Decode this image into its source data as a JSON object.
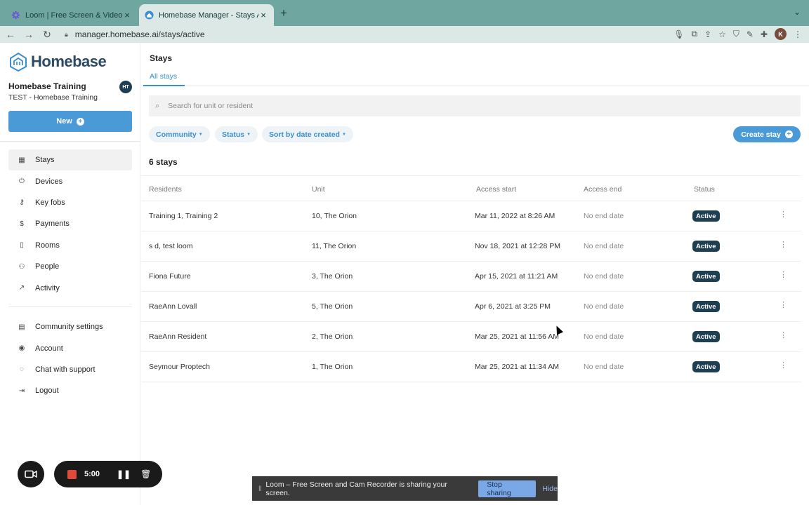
{
  "browser": {
    "tabs": [
      {
        "title": "Loom | Free Screen & Video Re"
      },
      {
        "title": "Homebase Manager - Stays Ac"
      }
    ],
    "url": "manager.homebase.ai/stays/active",
    "profile_initial": "K"
  },
  "sidebar": {
    "logo_text": "Homebase",
    "org_name": "Homebase Training",
    "org_sub": "TEST - Homebase Training",
    "user_initials": "HT",
    "new_label": "New",
    "items": [
      {
        "label": "Stays",
        "icon": "calendar-icon"
      },
      {
        "label": "Devices",
        "icon": "power-icon"
      },
      {
        "label": "Key fobs",
        "icon": "key-icon"
      },
      {
        "label": "Payments",
        "icon": "dollar-icon"
      },
      {
        "label": "Rooms",
        "icon": "door-icon"
      },
      {
        "label": "People",
        "icon": "people-icon"
      },
      {
        "label": "Activity",
        "icon": "chart-icon"
      }
    ],
    "secondary_items": [
      {
        "label": "Community settings",
        "icon": "building-icon"
      },
      {
        "label": "Account",
        "icon": "user-circle-icon"
      },
      {
        "label": "Chat with support",
        "icon": "chat-icon"
      },
      {
        "label": "Logout",
        "icon": "logout-icon"
      }
    ]
  },
  "main": {
    "title": "Stays",
    "subtab": "All stays",
    "search_placeholder": "Search for unit or resident",
    "filters": [
      "Community",
      "Status",
      "Sort by date created"
    ],
    "create_label": "Create stay",
    "count_label": "6 stays",
    "columns": [
      "Residents",
      "Unit",
      "Access start",
      "Access end",
      "Status"
    ],
    "rows": [
      {
        "residents": "Training 1, Training 2",
        "unit": "10, The Orion",
        "start": "Mar 11, 2022 at 8:26 AM",
        "end": "No end date",
        "status": "Active"
      },
      {
        "residents": "s d, test loom",
        "unit": "11, The Orion",
        "start": "Nov 18, 2021 at 12:28 PM",
        "end": "No end date",
        "status": "Active"
      },
      {
        "residents": "Fiona Future",
        "unit": "3, The Orion",
        "start": "Apr 15, 2021 at 11:21 AM",
        "end": "No end date",
        "status": "Active"
      },
      {
        "residents": "RaeAnn Lovall",
        "unit": "5, The Orion",
        "start": "Apr 6, 2021 at 3:25 PM",
        "end": "No end date",
        "status": "Active"
      },
      {
        "residents": "RaeAnn Resident",
        "unit": "2, The Orion",
        "start": "Mar 25, 2021 at 11:56 AM",
        "end": "No end date",
        "status": "Active"
      },
      {
        "residents": "Seymour Proptech",
        "unit": "1, The Orion",
        "start": "Mar 25, 2021 at 11:34 AM",
        "end": "No end date",
        "status": "Active"
      }
    ]
  },
  "loom": {
    "timer": "5:00",
    "share_message": "Loom – Free Screen and Cam Recorder is sharing your screen.",
    "stop_label": "Stop sharing",
    "hide_label": "Hide"
  },
  "colors": {
    "accent": "#4a9ad8",
    "badge": "#1e3f52"
  }
}
